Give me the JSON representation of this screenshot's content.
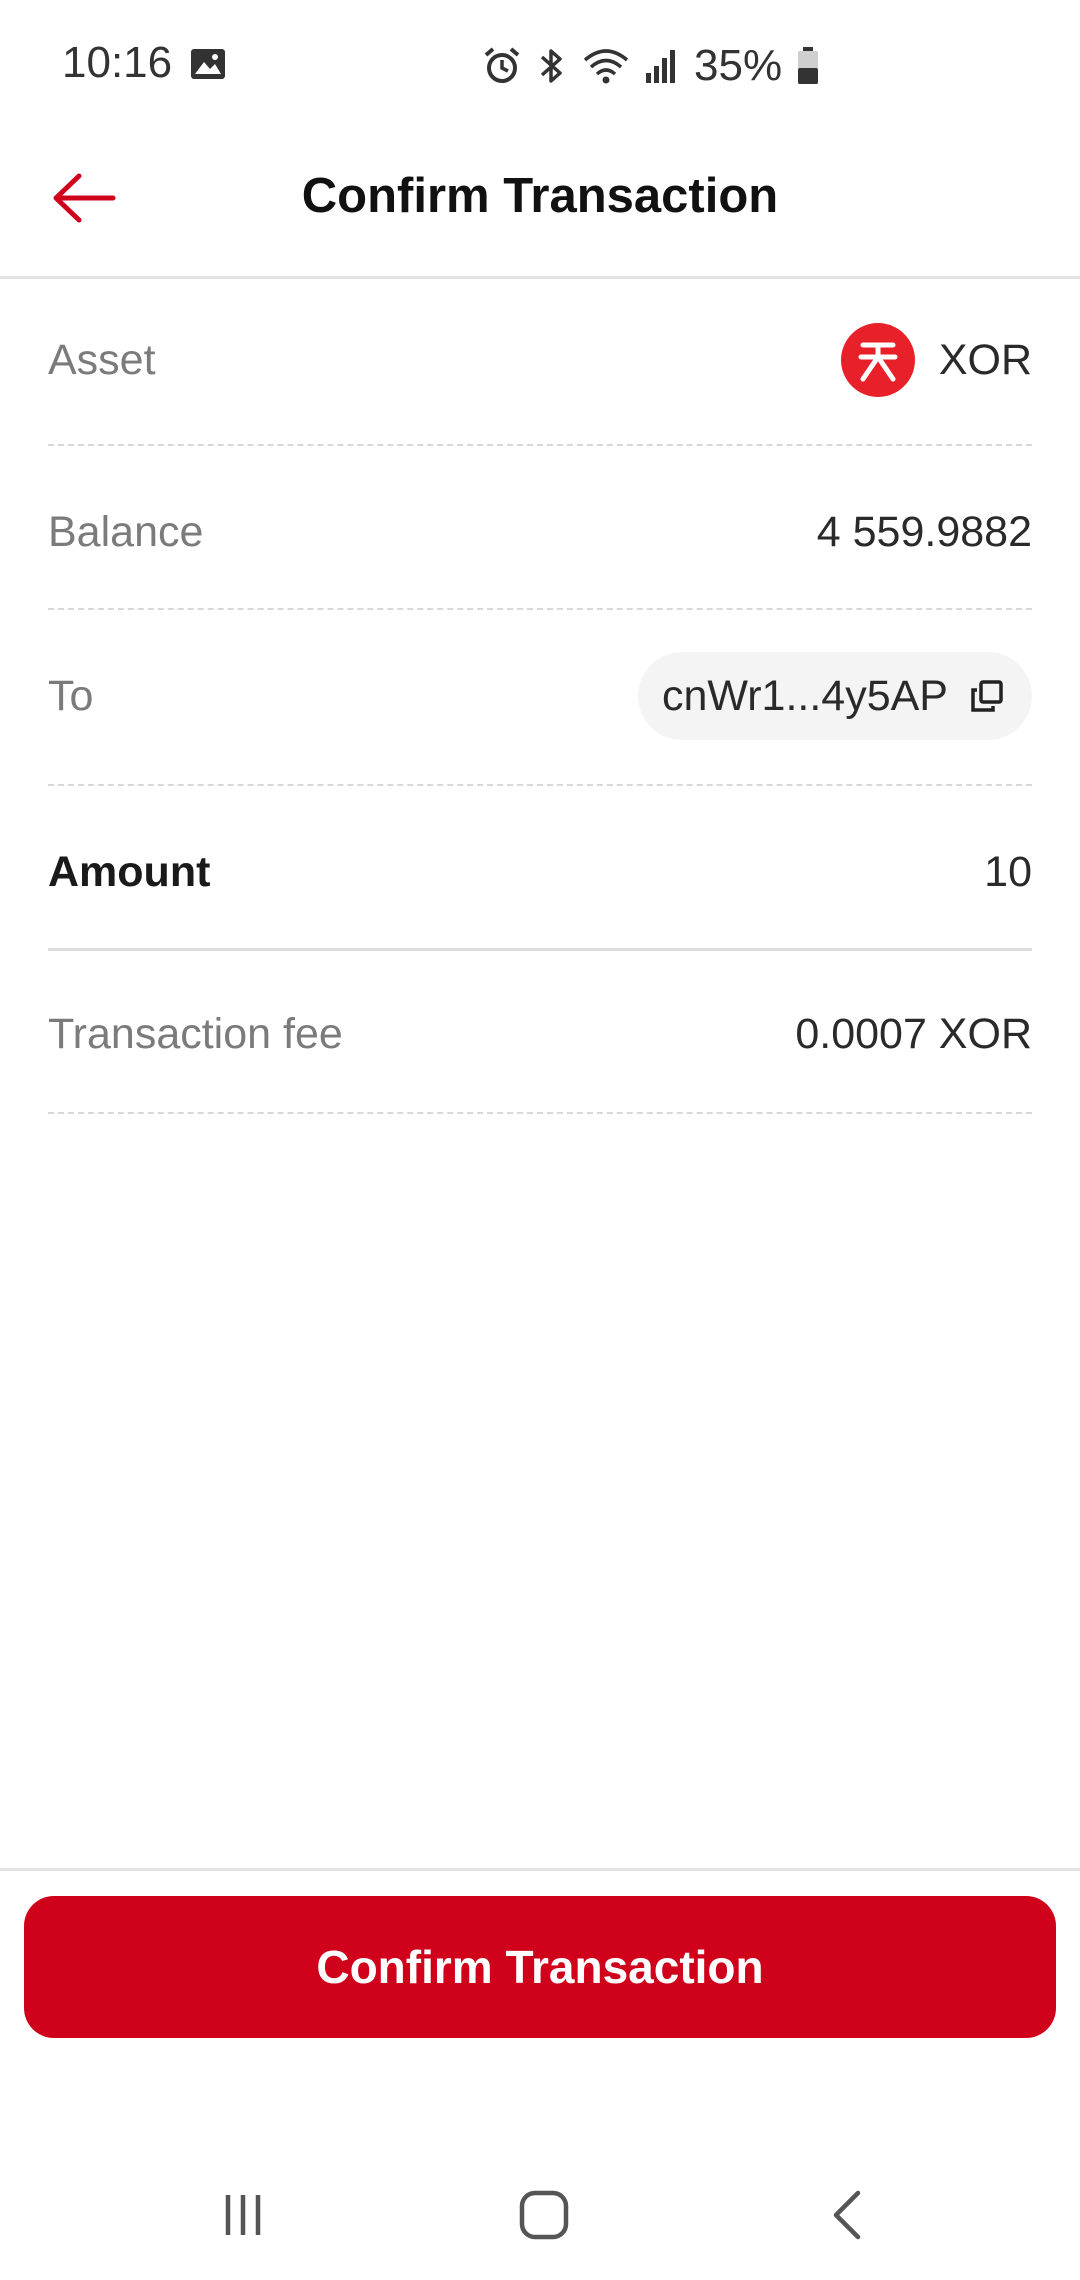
{
  "status_bar": {
    "time": "10:16",
    "battery_pct": "35%",
    "icons": [
      "image-icon",
      "alarm-icon",
      "bluetooth-icon",
      "wifi-icon",
      "signal-icon",
      "battery-icon"
    ]
  },
  "header": {
    "title": "Confirm Transaction",
    "back_icon": "arrow-left-icon"
  },
  "details": {
    "asset": {
      "label": "Asset",
      "value": "XOR",
      "icon": "xor-token-icon"
    },
    "balance": {
      "label": "Balance",
      "value": "4 559.9882"
    },
    "to": {
      "label": "To",
      "value": "cnWr1...4y5AP",
      "icon": "copy-icon"
    },
    "amount": {
      "label": "Amount",
      "value": "10"
    },
    "fee": {
      "label": "Transaction fee",
      "value": "0.0007 XOR"
    }
  },
  "confirm_button": {
    "label": "Confirm Transaction"
  },
  "nav_bar": {
    "icons": [
      "recent-apps-icon",
      "home-icon",
      "back-icon"
    ]
  },
  "colors": {
    "accent": "#d0021b",
    "xor_logo": "#e8202a"
  }
}
